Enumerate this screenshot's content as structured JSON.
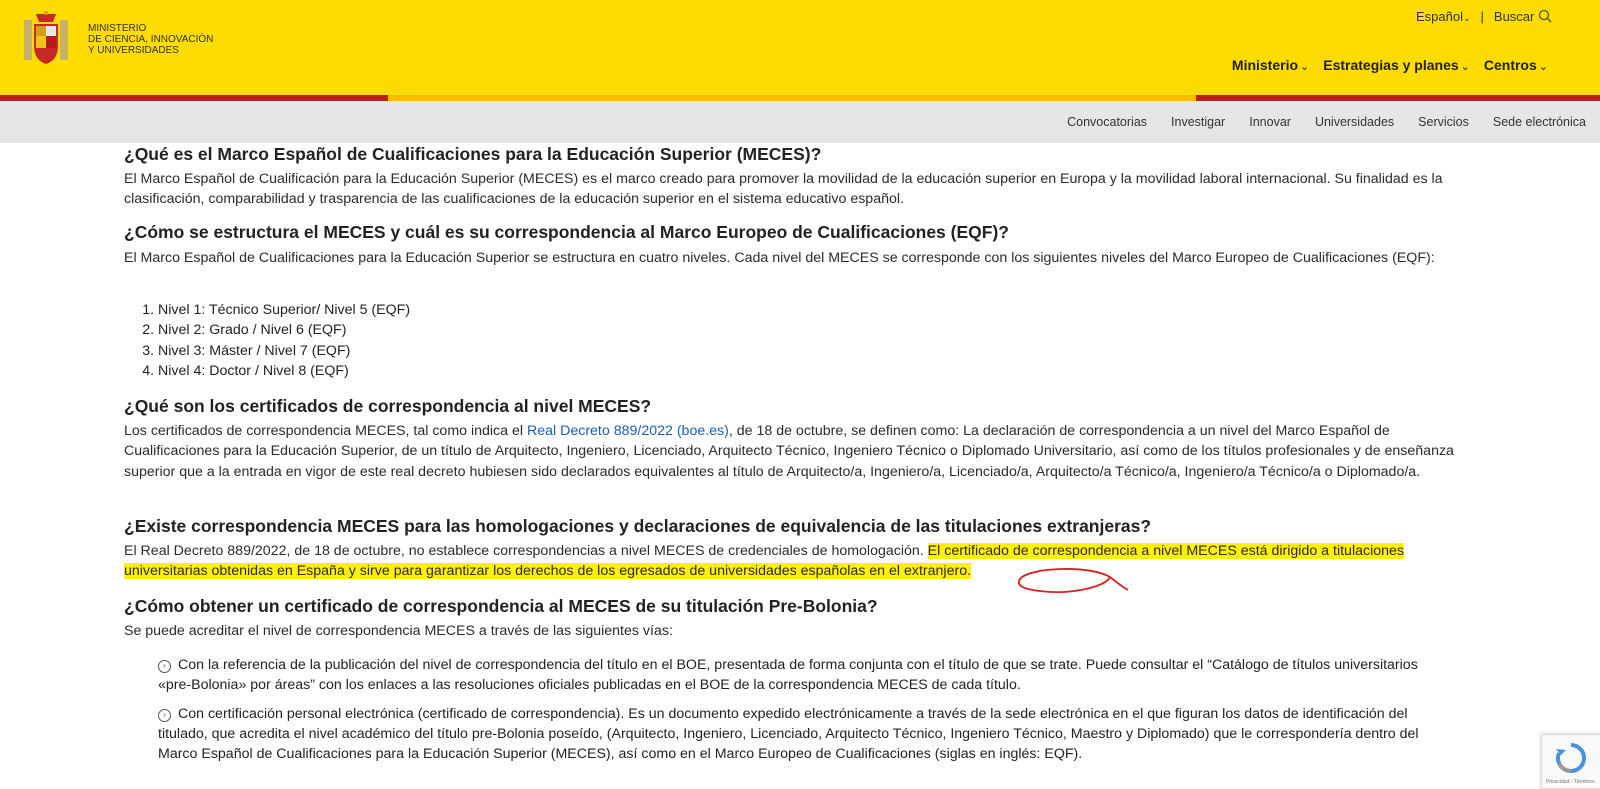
{
  "header": {
    "logo_line1": "MINISTERIO",
    "logo_line2": "DE CIENCIA, INNOVACIÓN",
    "logo_line3": "Y UNIVERSIDADES",
    "language": "Español",
    "search": "Buscar",
    "main_nav": [
      "Ministerio",
      "Estrategias y planes",
      "Centros"
    ],
    "sub_nav": [
      "Convocatorias",
      "Investigar",
      "Innovar",
      "Universidades",
      "Servicios",
      "Sede electrónica"
    ]
  },
  "content": {
    "q1": "¿Qué es el Marco Español de Cualificaciones para la Educación Superior (MECES)?",
    "p1": "El Marco Español de Cualificación para la Educación Superior (MECES) es el marco creado para promover la movilidad de la educación superior en Europa y la movilidad laboral internacional. Su finalidad es la clasificación, comparabilidad y trasparencia de las cualificaciones de la educación superior en el sistema educativo español.",
    "q2": "¿Cómo se estructura el MECES y cuál es su correspondencia al Marco Europeo de Cualificaciones (EQF)?",
    "p2": "El Marco Español de Cualificaciones para la Educación Superior se estructura en cuatro niveles. Cada nivel del MECES se corresponde con los siguientes niveles del Marco Europeo de Cualificaciones (EQF):",
    "levels": [
      "Nivel 1: Técnico Superior/ Nivel 5 (EQF)",
      "Nivel 2: Grado / Nivel 6 (EQF)",
      "Nivel 3: Máster / Nivel 7 (EQF)",
      "Nivel 4: Doctor / Nivel 8 (EQF)"
    ],
    "q3": "¿Qué son los certificados de correspondencia al nivel MECES?",
    "p3_before": "Los certificados de correspondencia MECES, tal como indica el ",
    "p3_link": "Real Decreto 889/2022 (boe.es)",
    "p3_after": ", de 18 de octubre, se definen como: La declaración de correspondencia a un nivel del Marco Español de Cualificaciones para la Educación Superior, de un título de Arquitecto, Ingeniero, Licenciado, Arquitecto Técnico, Ingeniero Técnico o Diplomado Universitario, así como de los títulos profesionales y de enseñanza superior que a la entrada en vigor de este real decreto hubiesen sido declarados equivalentes al título de Arquitecto/a, Ingeniero/a, Licenciado/a, Arquitecto/a Técnico/a, Ingeniero/a Técnico/a o Diplomado/a.",
    "q4": "¿Existe correspondencia MECES para las homologaciones y declaraciones de equivalencia de las titulaciones extranjeras?",
    "p4_plain": "El Real Decreto 889/2022, de 18 de octubre, no establece correspondencias a nivel MECES de credenciales de homologación. ",
    "p4_highlight": "El certificado de correspondencia a nivel MECES está dirigido a titulaciones universitarias obtenidas en España y sirve para garantizar los derechos de los egresados de universidades españolas en el extranjero.",
    "q5": "¿Cómo obtener un certificado de correspondencia al MECES de su titulación Pre-Bolonia?",
    "p5": "Se puede acreditar el nivel de correspondencia MECES a través de las siguientes vías:",
    "bullets": [
      "Con la referencia de la publicación del nivel de correspondencia del título en el BOE, presentada de forma conjunta con el título de que se trate. Puede consultar el “Catálogo de títulos universitarios «pre-Bolonia» por áreas” con los enlaces a las resoluciones oficiales publicadas en el BOE de la correspondencia MECES de cada título.",
      "Con certificación personal electrónica (certificado de correspondencia). Es un documento expedido electrónicamente a través de la sede electrónica en el que figuran los datos de identificación del titulado, que acredita el nivel académico del título pre-Bolonia poseído, (Arquitecto, Ingeniero, Licenciado, Arquitecto Técnico, Ingeniero Técnico, Maestro y Diplomado) que le correspondería dentro del Marco Español de Cualificaciones para la Educación Superior (MECES), así como en el Marco Europeo de Cualificaciones (siglas en inglés: EQF)."
    ]
  },
  "recaptcha": "Privacidad - Términos",
  "colors": {
    "yellow": "#fedc00",
    "red": "#b51f24",
    "highlight": "#fff200",
    "link": "#1a5fb4"
  }
}
